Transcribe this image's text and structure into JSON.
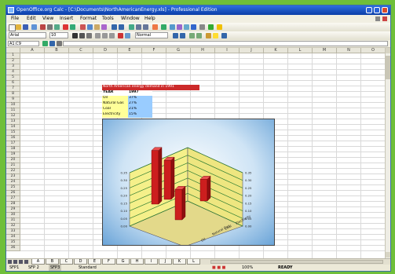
{
  "window": {
    "title": "OpenOffice.org Calc - [C:\\Documents\\NorthAmericanEnergy.xls] - Professional Edition"
  },
  "menu": [
    "File",
    "Edit",
    "View",
    "Insert",
    "Format",
    "Tools",
    "Window",
    "Help"
  ],
  "format_bar": {
    "font": "Arial",
    "size": "10",
    "style": "Normal",
    "zoom": "100%"
  },
  "formula_bar": {
    "name_box": "A1:C9"
  },
  "columns": [
    "A",
    "B",
    "C",
    "D",
    "E",
    "F",
    "G",
    "H",
    "I",
    "J",
    "K",
    "L",
    "M",
    "N",
    "O"
  ],
  "rows": [
    "1",
    "2",
    "3",
    "4",
    "5",
    "6",
    "7",
    "8",
    "9",
    "10",
    "11",
    "12",
    "13",
    "14",
    "15",
    "16",
    "17",
    "18",
    "19",
    "20",
    "21",
    "22",
    "23",
    "24",
    "25",
    "26",
    "27",
    "28",
    "29",
    "30",
    "31",
    "32",
    "33",
    "34",
    "35",
    "36"
  ],
  "table": {
    "title": "North American energy demand in 1991",
    "header": [
      "YEAR",
      "1997"
    ],
    "rows": [
      {
        "label": "Oil",
        "value": "37%"
      },
      {
        "label": "Natural Gas",
        "value": "27%"
      },
      {
        "label": "Coal",
        "value": "21%"
      },
      {
        "label": "Electricity",
        "value": "15%"
      }
    ]
  },
  "chart_data": {
    "type": "bar",
    "categories": [
      "Oil",
      "Natural Gas",
      "Coal",
      "Electricity"
    ],
    "values": [
      37,
      27,
      21,
      15
    ],
    "axis_ticks": [
      "0.00",
      "0.05",
      "0.10",
      "0.15",
      "0.20",
      "0.25",
      "0.30",
      "0.35"
    ],
    "ylim": [
      0,
      0.35
    ],
    "colors": {
      "bar": "#cc1e1e",
      "wall": "#f5f08a",
      "floor": "#e6dd8a",
      "grid": "#2e7d32"
    }
  },
  "sheet_tabs": [
    "A",
    "B",
    "C",
    "D",
    "E",
    "F",
    "G",
    "H",
    "I",
    "J",
    "K",
    "L"
  ],
  "status": {
    "left": [
      "SFP1",
      "SFP 2",
      "SFP3"
    ],
    "sheet": "Standard",
    "zoom": "100%",
    "mode": "READY"
  },
  "colors": {
    "title_red": "#cc2a2a",
    "label_yellow": "#ffff99",
    "value_cyan": "#99ccff",
    "frame_green": "#6fbf3a"
  }
}
